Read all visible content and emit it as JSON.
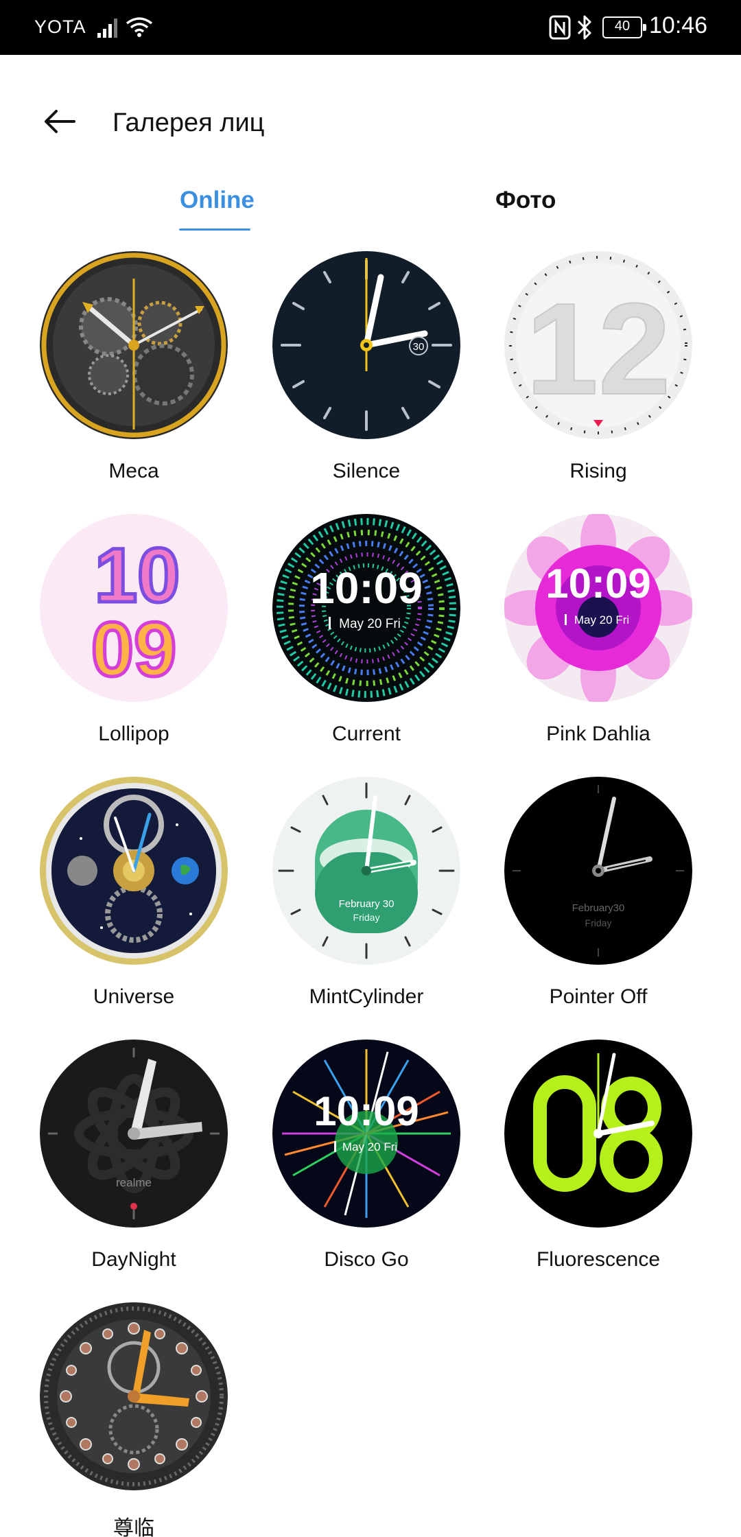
{
  "status_bar": {
    "carrier": "YOTA",
    "battery": "40",
    "time": "10:46"
  },
  "header": {
    "title": "Галерея лиц"
  },
  "tabs": [
    {
      "label": "Online",
      "active": true
    },
    {
      "label": "Фото",
      "active": false
    }
  ],
  "faces": [
    {
      "name": "Meca"
    },
    {
      "name": "Silence",
      "badge": "30"
    },
    {
      "name": "Rising",
      "numeral": "12"
    },
    {
      "name": "Lollipop",
      "top": "10",
      "bottom": "09"
    },
    {
      "name": "Current",
      "time": "10:09",
      "date": "May 20 Fri"
    },
    {
      "name": "Pink Dahlia",
      "time": "10:09",
      "date": "May 20 Fri"
    },
    {
      "name": "Universe"
    },
    {
      "name": "MintCylinder",
      "date": "February 30",
      "day": "Friday"
    },
    {
      "name": "Pointer Off",
      "date": "February30",
      "day": "Friday"
    },
    {
      "name": "DayNight",
      "brand": "realme"
    },
    {
      "name": "Disco Go",
      "time": "10:09",
      "date": "May 20 Fri"
    },
    {
      "name": "Fluorescence",
      "numeral": "08"
    },
    {
      "name": "尊临"
    }
  ],
  "colors": {
    "accent": "#3b8fe0",
    "fluorescent": "#b6f01a",
    "dahlia": "#e62ad8"
  }
}
